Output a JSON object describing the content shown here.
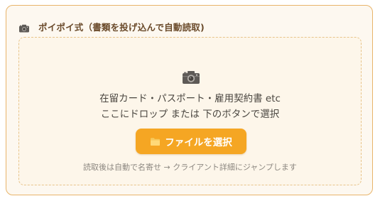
{
  "panel": {
    "title": "ポイポイ式（書類を投げ込んで自動読取)",
    "header_icon": "camera-icon"
  },
  "dropzone": {
    "icon": "camera-icon",
    "line1": "在留カード・パスポート・雇用契約書 etc",
    "line2": "ここにドロップ または 下のボタンで選択",
    "button_icon": "folder-icon",
    "button_label": "ファイルを選択",
    "hint": "読取後は自動で名寄せ → クライアント詳細にジャンプします"
  },
  "colors": {
    "accent": "#f5a623",
    "panel_border": "#e8b46a",
    "panel_bg": "#fdf8f0",
    "dropzone_border": "#e8c48a",
    "title_text": "#6a4a2a"
  }
}
